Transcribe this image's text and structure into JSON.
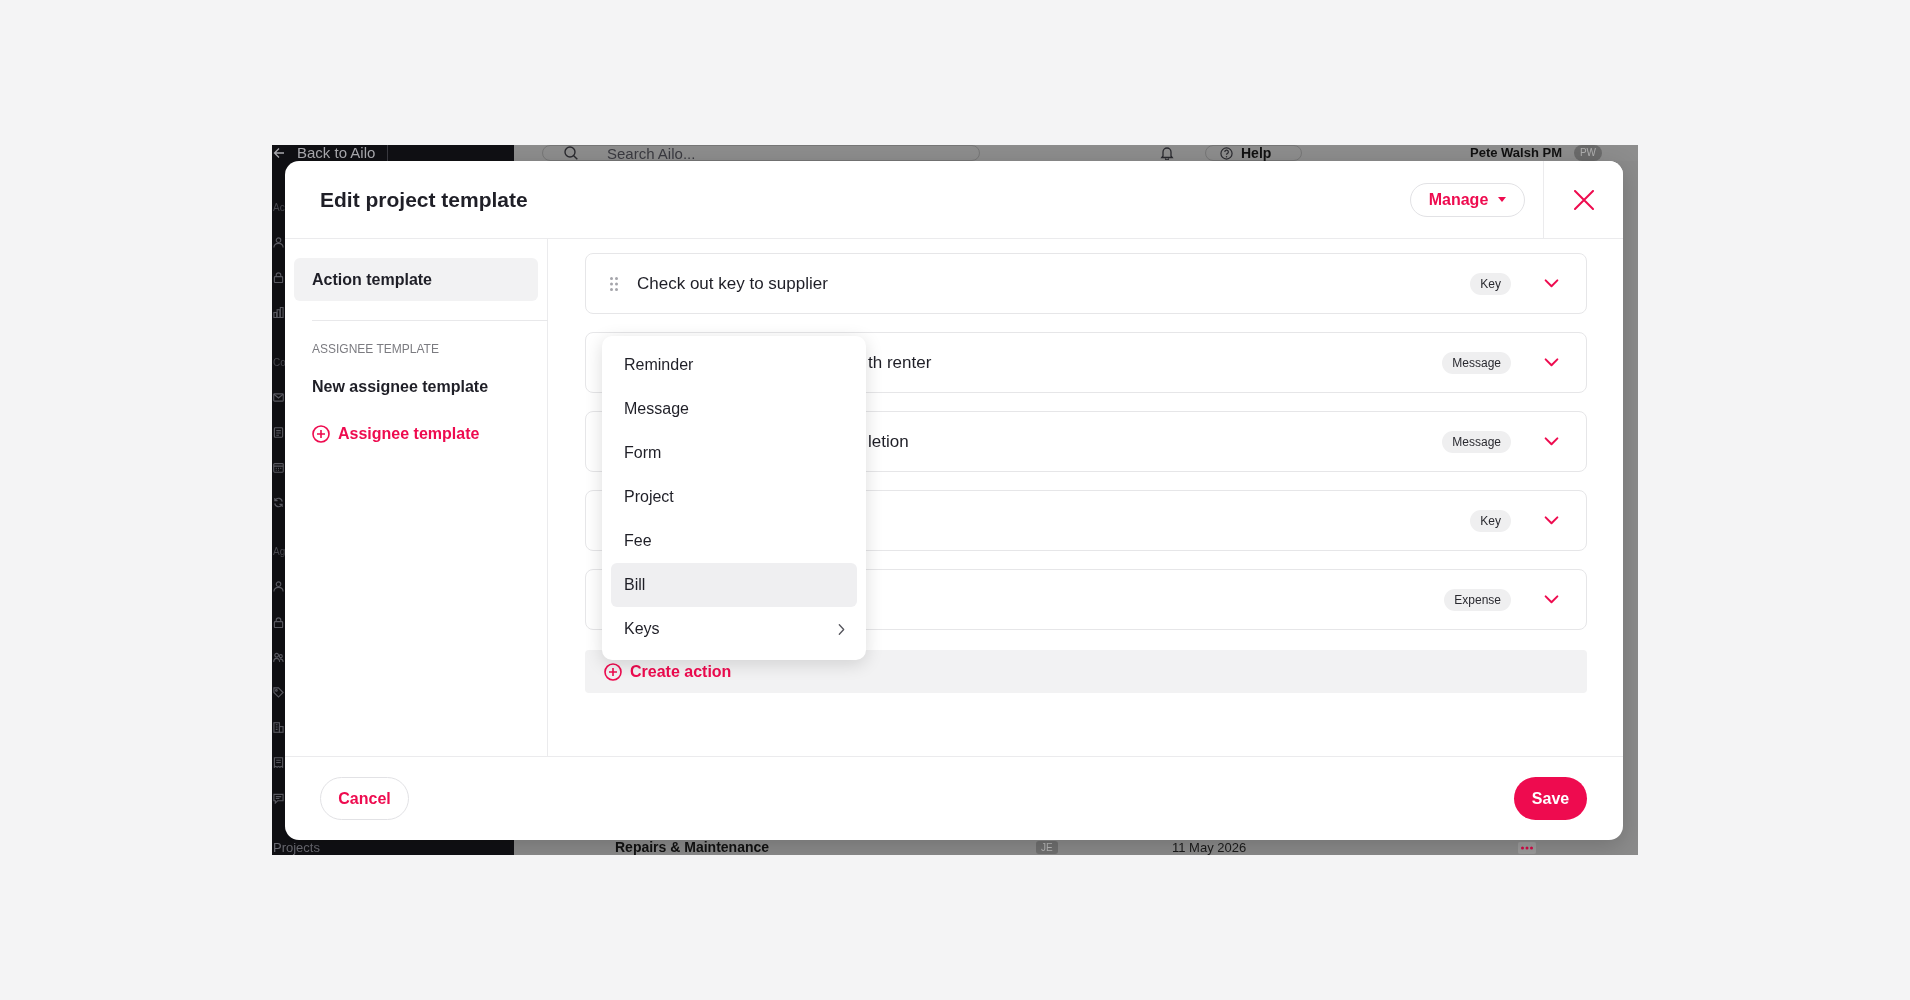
{
  "background_app": {
    "back_link": "Back to Ailo",
    "nav_sections": [
      {
        "heading": "Ac"
      },
      {
        "heading": "Co"
      },
      {
        "heading": "Ag"
      }
    ],
    "nav_footer": "Projects",
    "search": {
      "placeholder": "Search Ailo..."
    },
    "help_button": "Help",
    "user": {
      "name": "Pete Walsh PM",
      "initials": "PW"
    },
    "table_row": {
      "title": "Repairs & Maintenance",
      "assignee": "JE",
      "date": "11 May 2026"
    }
  },
  "modal": {
    "title": "Edit project template",
    "manage_button": "Manage",
    "sidebar": {
      "items": [
        {
          "label": "Action template",
          "selected": true
        }
      ],
      "section_heading": "ASSIGNEE TEMPLATE",
      "section_items": [
        {
          "label": "New assignee template",
          "selected": false
        }
      ],
      "add_link": "Assignee template"
    },
    "actions": [
      {
        "title": "Check out key to supplier",
        "tag": "Key"
      },
      {
        "title": "th renter",
        "tag": "Message"
      },
      {
        "title": "letion",
        "tag": "Message"
      },
      {
        "tag": "Key"
      },
      {
        "tag": "Expense"
      }
    ],
    "create_action": "Create action",
    "type_menu": {
      "items": [
        {
          "label": "Reminder",
          "highlighted": false,
          "submenu": false
        },
        {
          "label": "Message",
          "highlighted": false,
          "submenu": false
        },
        {
          "label": "Form",
          "highlighted": false,
          "submenu": false
        },
        {
          "label": "Project",
          "highlighted": false,
          "submenu": false
        },
        {
          "label": "Fee",
          "highlighted": false,
          "submenu": false
        },
        {
          "label": "Bill",
          "highlighted": true,
          "submenu": false
        },
        {
          "label": "Keys",
          "highlighted": false,
          "submenu": true
        }
      ]
    },
    "cancel_button": "Cancel",
    "save_button": "Save"
  }
}
